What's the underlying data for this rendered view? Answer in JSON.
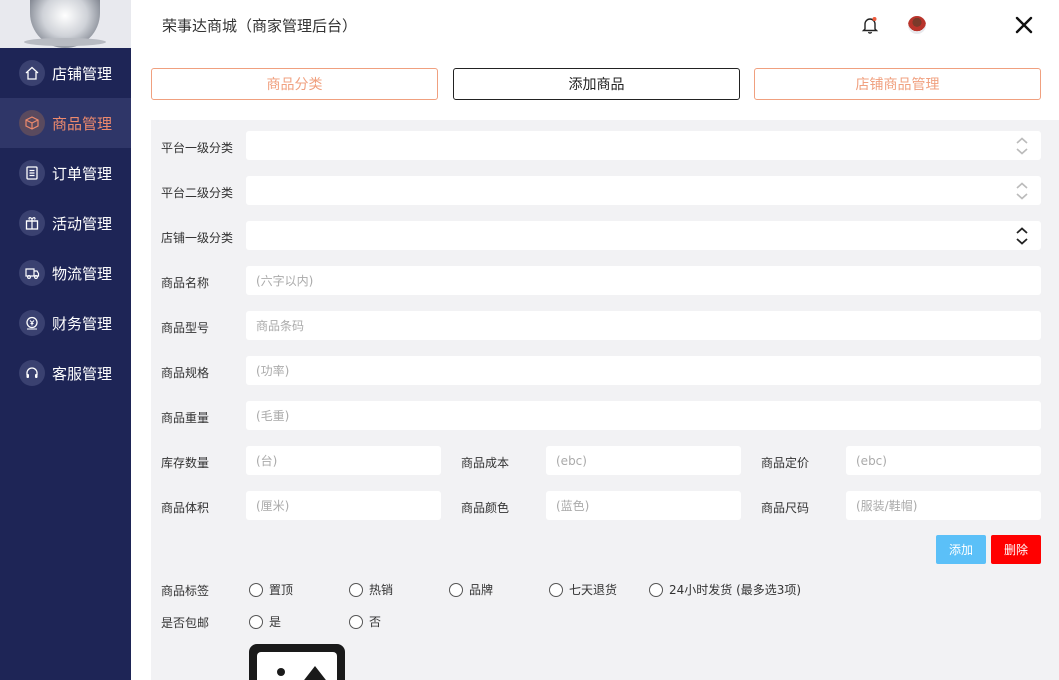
{
  "header": {
    "title": "荣事达商城（商家管理后台）"
  },
  "sidebar": {
    "items": [
      {
        "label": "店铺管理",
        "icon": "home-icon"
      },
      {
        "label": "商品管理",
        "icon": "box-icon",
        "active": true
      },
      {
        "label": "订单管理",
        "icon": "list-icon"
      },
      {
        "label": "活动管理",
        "icon": "gift-icon"
      },
      {
        "label": "物流管理",
        "icon": "truck-icon"
      },
      {
        "label": "财务管理",
        "icon": "finance-icon"
      },
      {
        "label": "客服管理",
        "icon": "headset-icon"
      }
    ]
  },
  "tabs": [
    {
      "label": "商品分类",
      "active": false
    },
    {
      "label": "添加商品",
      "active": true
    },
    {
      "label": "店铺商品管理",
      "active": false
    }
  ],
  "form": {
    "platform_cat1": {
      "label": "平台一级分类",
      "value": ""
    },
    "platform_cat2": {
      "label": "平台二级分类",
      "value": ""
    },
    "shop_cat1": {
      "label": "店铺一级分类",
      "value": ""
    },
    "name": {
      "label": "商品名称",
      "placeholder": "(六字以内)"
    },
    "model": {
      "label": "商品型号",
      "placeholder": "商品条码"
    },
    "spec": {
      "label": "商品规格",
      "placeholder": "(功率)"
    },
    "weight": {
      "label": "商品重量",
      "placeholder": "(毛重)"
    },
    "stock": {
      "label": "库存数量",
      "placeholder": "(台)"
    },
    "cost": {
      "label": "商品成本",
      "placeholder": "(ebc)"
    },
    "price": {
      "label": "商品定价",
      "placeholder": "(ebc)"
    },
    "volume": {
      "label": "商品体积",
      "placeholder": "(厘米)"
    },
    "color": {
      "label": "商品颜色",
      "placeholder": "(蓝色)"
    },
    "size": {
      "label": "商品尺码",
      "placeholder": "(服装/鞋帽)"
    },
    "add_button": "添加",
    "delete_button": "删除",
    "tags": {
      "label": "商品标签",
      "options": [
        "置顶",
        "热销",
        "品牌",
        "七天退货",
        "24小时发货 (最多选3项)"
      ]
    },
    "free_shipping": {
      "label": "是否包邮",
      "options": [
        "是",
        "否"
      ]
    }
  },
  "colors": {
    "sidebar_bg": "#1e2556",
    "accent": "#ee8a6d",
    "tab_border": "#f0a07f",
    "add_button": "#5bc0f8",
    "delete_button": "#ff0000",
    "form_bg": "#f2f2f4"
  }
}
